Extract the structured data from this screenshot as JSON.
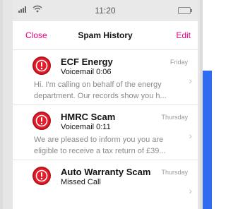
{
  "status_bar": {
    "time": "11:20"
  },
  "nav": {
    "close_label": "Close",
    "title": "Spam History",
    "edit_label": "Edit"
  },
  "items": [
    {
      "name": "ECF Energy",
      "subtitle": "Voicemail  0:06",
      "day": "Friday",
      "preview_line1": "Hi. I'm calling on behalf of the energy",
      "preview_line2": "department. Our records show you h...",
      "unread": false
    },
    {
      "name": "HMRC Scam",
      "subtitle": "Voicemail  0:11",
      "day": "Thursday",
      "preview_line1": "We are pleased to inform you you are",
      "preview_line2": "eligible to receive a tax return of £39...",
      "unread": true
    },
    {
      "name": "Auto Warranty Scam",
      "subtitle": "Missed Call",
      "day": "Thursday",
      "unread": true
    }
  ],
  "colors": {
    "accent": "#e6007e",
    "alert_red": "#e51d2a",
    "backdrop_blue": "#2f6bf0"
  },
  "icons": {
    "alert": "exclamation-circle-icon",
    "chevron": "chevron-right-icon",
    "signal": "signal-bars-icon",
    "wifi": "wifi-icon",
    "battery": "battery-icon"
  }
}
